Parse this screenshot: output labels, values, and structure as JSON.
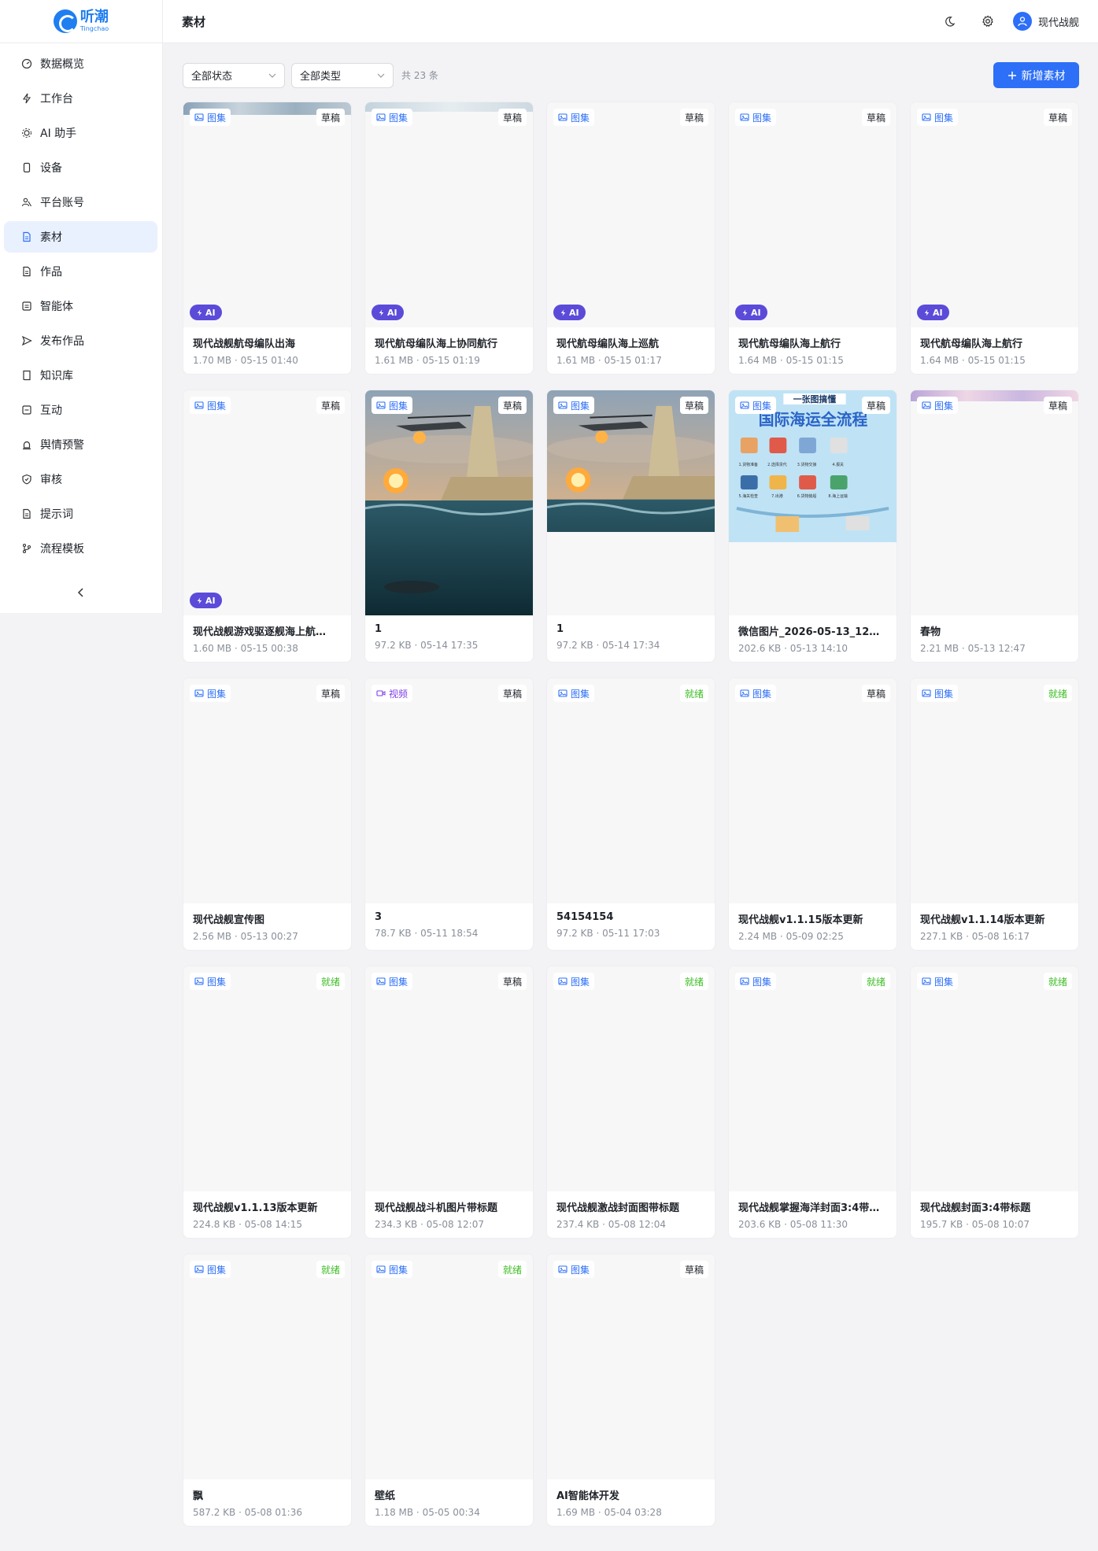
{
  "app": {
    "logo_cn": "听潮",
    "logo_en": "Tingchao"
  },
  "sidebar": {
    "items": [
      {
        "label": "数据概览",
        "icon": "dashboard-icon"
      },
      {
        "label": "工作台",
        "icon": "bolt-icon"
      },
      {
        "label": "AI 助手",
        "icon": "ai-assistant-icon"
      },
      {
        "label": "设备",
        "icon": "device-icon"
      },
      {
        "label": "平台账号",
        "icon": "users-icon"
      },
      {
        "label": "素材",
        "icon": "material-icon",
        "active": true
      },
      {
        "label": "作品",
        "icon": "works-icon"
      },
      {
        "label": "智能体",
        "icon": "agent-icon"
      },
      {
        "label": "发布作品",
        "icon": "send-icon"
      },
      {
        "label": "知识库",
        "icon": "book-icon"
      },
      {
        "label": "互动",
        "icon": "interaction-icon"
      },
      {
        "label": "舆情预警",
        "icon": "alarm-icon"
      },
      {
        "label": "审核",
        "icon": "shield-icon"
      },
      {
        "label": "提示词",
        "icon": "prompt-icon"
      },
      {
        "label": "流程模板",
        "icon": "flow-icon"
      }
    ]
  },
  "header": {
    "title": "素材",
    "username": "现代战舰"
  },
  "toolbar": {
    "status_filter": "全部状态",
    "type_filter": "全部类型",
    "count": "共 23 条",
    "add_label": "新增素材"
  },
  "cards": [
    {
      "type": "图集",
      "status": "草稿",
      "ai": "AI",
      "name": "现代战舰航母编队出海",
      "info": "1.70 MB · 05-15 01:40",
      "thumb": "sky"
    },
    {
      "type": "图集",
      "status": "草稿",
      "ai": "AI",
      "name": "现代航母编队海上协同航行",
      "info": "1.61 MB · 05-15 01:19",
      "thumb": "sky-light"
    },
    {
      "type": "图集",
      "status": "草稿",
      "ai": "AI",
      "name": "现代航母编队海上巡航",
      "info": "1.61 MB · 05-15 01:17",
      "thumb": "none"
    },
    {
      "type": "图集",
      "status": "草稿",
      "ai": "AI",
      "name": "现代航母编队海上航行",
      "info": "1.64 MB · 05-15 01:15",
      "thumb": "none"
    },
    {
      "type": "图集",
      "status": "草稿",
      "ai": "AI",
      "name": "现代航母编队海上航行",
      "info": "1.64 MB · 05-15 01:15",
      "thumb": "none"
    },
    {
      "type": "图集",
      "status": "草稿",
      "ai": "AI",
      "name": "现代战舰游戏驱逐舰海上航…",
      "info": "1.60 MB · 05-15 00:38",
      "thumb": "none"
    },
    {
      "type": "图集",
      "status": "草稿",
      "ai": "",
      "name": "1",
      "info": "97.2 KB · 05-14 17:35",
      "thumb": "battle-full"
    },
    {
      "type": "图集",
      "status": "草稿",
      "ai": "",
      "name": "1",
      "info": "97.2 KB · 05-14 17:34",
      "thumb": "battle-half"
    },
    {
      "type": "图集",
      "status": "草稿",
      "ai": "",
      "name": "微信图片_2026-05-13_12…",
      "info": "202.6 KB · 05-13 14:10",
      "thumb": "infographic"
    },
    {
      "type": "图集",
      "status": "草稿",
      "ai": "",
      "name": "春物",
      "info": "2.21 MB · 05-13 12:47",
      "thumb": "pink-sky"
    },
    {
      "type": "图集",
      "status": "草稿",
      "ai": "",
      "name": "现代战舰宣传图",
      "info": "2.56 MB · 05-13 00:27",
      "thumb": "none"
    },
    {
      "type": "视频",
      "status": "草稿",
      "ai": "",
      "name": "3",
      "info": "78.7 KB · 05-11 18:54",
      "thumb": "none"
    },
    {
      "type": "图集",
      "status": "就绪",
      "ai": "",
      "name": "54154154",
      "info": "97.2 KB · 05-11 17:03",
      "thumb": "none"
    },
    {
      "type": "图集",
      "status": "草稿",
      "ai": "",
      "name": "现代战舰v1.1.15版本更新",
      "info": "2.24 MB · 05-09 02:25",
      "thumb": "none"
    },
    {
      "type": "图集",
      "status": "就绪",
      "ai": "",
      "name": "现代战舰v1.1.14版本更新",
      "info": "227.1 KB · 05-08 16:17",
      "thumb": "none"
    },
    {
      "type": "图集",
      "status": "就绪",
      "ai": "",
      "name": "现代战舰v1.1.13版本更新",
      "info": "224.8 KB · 05-08 14:15",
      "thumb": "none"
    },
    {
      "type": "图集",
      "status": "草稿",
      "ai": "",
      "name": "现代战舰战斗机图片带标题",
      "info": "234.3 KB · 05-08 12:07",
      "thumb": "none"
    },
    {
      "type": "图集",
      "status": "就绪",
      "ai": "",
      "name": "现代战舰激战封面图带标题",
      "info": "237.4 KB · 05-08 12:04",
      "thumb": "none"
    },
    {
      "type": "图集",
      "status": "就绪",
      "ai": "",
      "name": "现代战舰掌握海洋封面3:4带…",
      "info": "203.6 KB · 05-08 11:30",
      "thumb": "none"
    },
    {
      "type": "图集",
      "status": "就绪",
      "ai": "",
      "name": "现代战舰封面3:4带标题",
      "info": "195.7 KB · 05-08 10:07",
      "thumb": "none"
    },
    {
      "type": "图集",
      "status": "就绪",
      "ai": "",
      "name": "飘",
      "info": "587.2 KB · 05-08 01:36",
      "thumb": "none"
    },
    {
      "type": "图集",
      "status": "就绪",
      "ai": "",
      "name": "壁纸",
      "info": "1.18 MB · 05-05 00:34",
      "thumb": "none"
    },
    {
      "type": "图集",
      "status": "草稿",
      "ai": "",
      "name": "AI智能体开发",
      "info": "1.69 MB · 05-04 03:28",
      "thumb": "none"
    }
  ],
  "infographic": {
    "title_top": "一张图搞懂",
    "title_main": "国际海运全流程",
    "steps": [
      "1.货物准备",
      "2.选择货代",
      "3.货物交接",
      "4.报关",
      "5.海关检查",
      "7.出港",
      "6.货物装船",
      "8.海上运输"
    ]
  },
  "colors": {
    "accent": "#2d6ff7",
    "ai_badge": "#5b4bd8",
    "ready": "#3dbd24",
    "video": "#7b3fe4"
  }
}
